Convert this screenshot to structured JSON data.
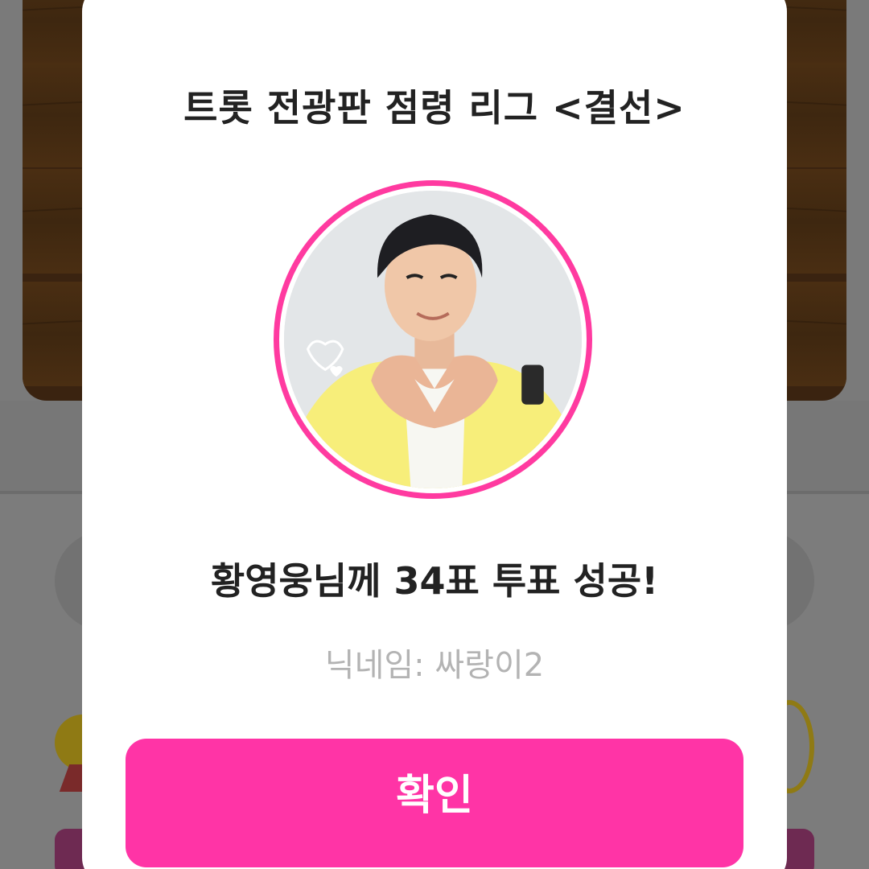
{
  "dialog": {
    "title": "트롯 전광판 점령 리그 <결선>",
    "avatar_description_icon": "profile-photo",
    "success_message": "황영웅님께 34표 투표 성공!",
    "nickname_label": "닉네임:",
    "nickname_value": "싸랑이2",
    "confirm_label": "확인"
  },
  "colors": {
    "accent": "#ff34a6",
    "ring": "#ff3aa0",
    "title_text": "#222222",
    "muted_text": "#b3b3b3",
    "overlay": "#7a7a7a"
  }
}
